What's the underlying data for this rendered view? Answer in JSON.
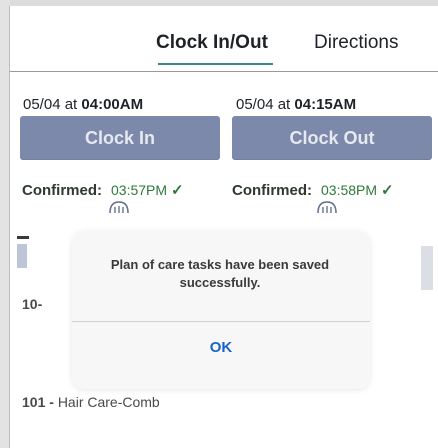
{
  "tabs": [
    {
      "label": "Clock In/Out",
      "active": true
    },
    {
      "label": "Directions",
      "active": false
    }
  ],
  "punches": {
    "in": {
      "date": "05/04 at ",
      "time": "04:00AM"
    },
    "out": {
      "date": "05/04 at ",
      "time": "04:15AM"
    }
  },
  "buttons": {
    "clock_in": "Clock In",
    "clock_out": "Clock Out"
  },
  "confirmations": {
    "in": {
      "label": "Confirmed:",
      "time": "03:57PM",
      "check": "✓"
    },
    "out": {
      "label": "Confirmed:",
      "time": "03:58PM",
      "check": "✓"
    }
  },
  "icons": {
    "location_badge": "location-badge-icon",
    "check": "check-icon"
  },
  "background_rows": {
    "row1": "10-",
    "row2_prefix": "101 - ",
    "row2_text": "Hair Care-Comb"
  },
  "dialog": {
    "message": "Plan of care tasks have been saved successfully.",
    "ok_label": "OK"
  },
  "colors": {
    "accent": "#3b8a82",
    "button": "#7d89aa",
    "confirm_time": "#2f7a3a",
    "dialog_ok": "#1a63c9"
  }
}
